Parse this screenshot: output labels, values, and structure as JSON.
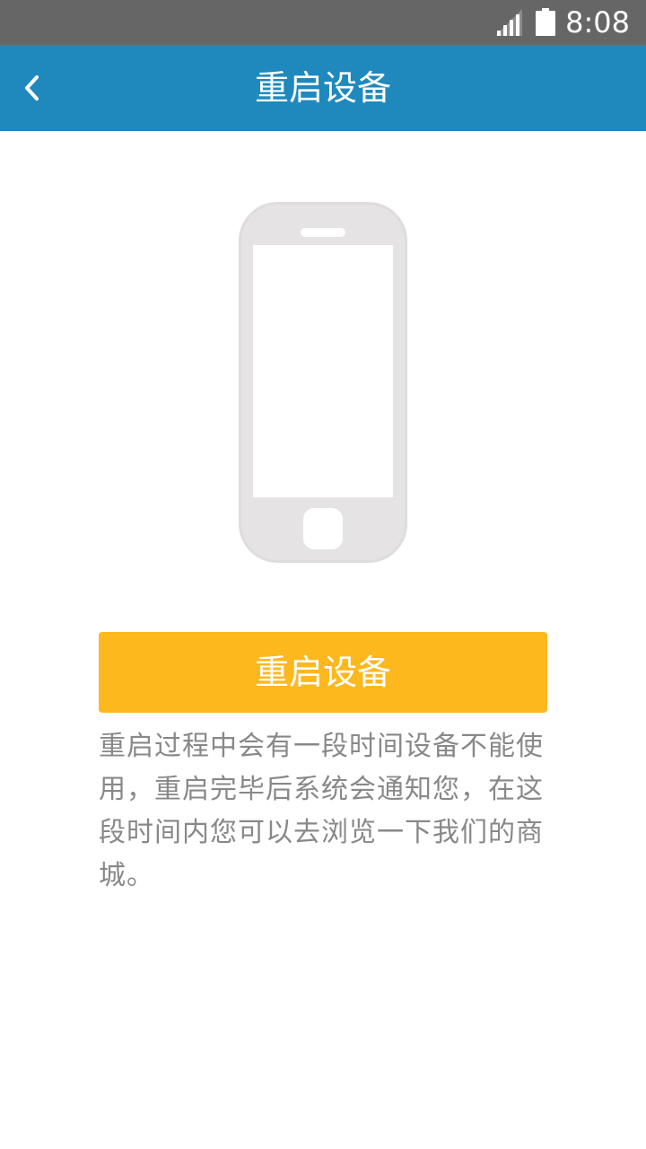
{
  "status_bar": {
    "time": "8:08",
    "icons": [
      "signal-icon",
      "battery-icon"
    ]
  },
  "app_bar": {
    "back_icon": "chevron-left-icon",
    "title": "重启设备"
  },
  "illustration": {
    "icon": "smartphone-icon"
  },
  "restart_button": {
    "label": "重启设备"
  },
  "info": {
    "text": "重启过程中会有一段时间设备不能使用，重启完毕后系统会通知您，在这段时间内您可以去浏览一下我们的商城。"
  },
  "colors": {
    "status_bar": "#666666",
    "app_bar": "#1f89bd",
    "button": "#fdb81e",
    "body_text": "#888888",
    "phone_outline": "#e5e3e4"
  }
}
